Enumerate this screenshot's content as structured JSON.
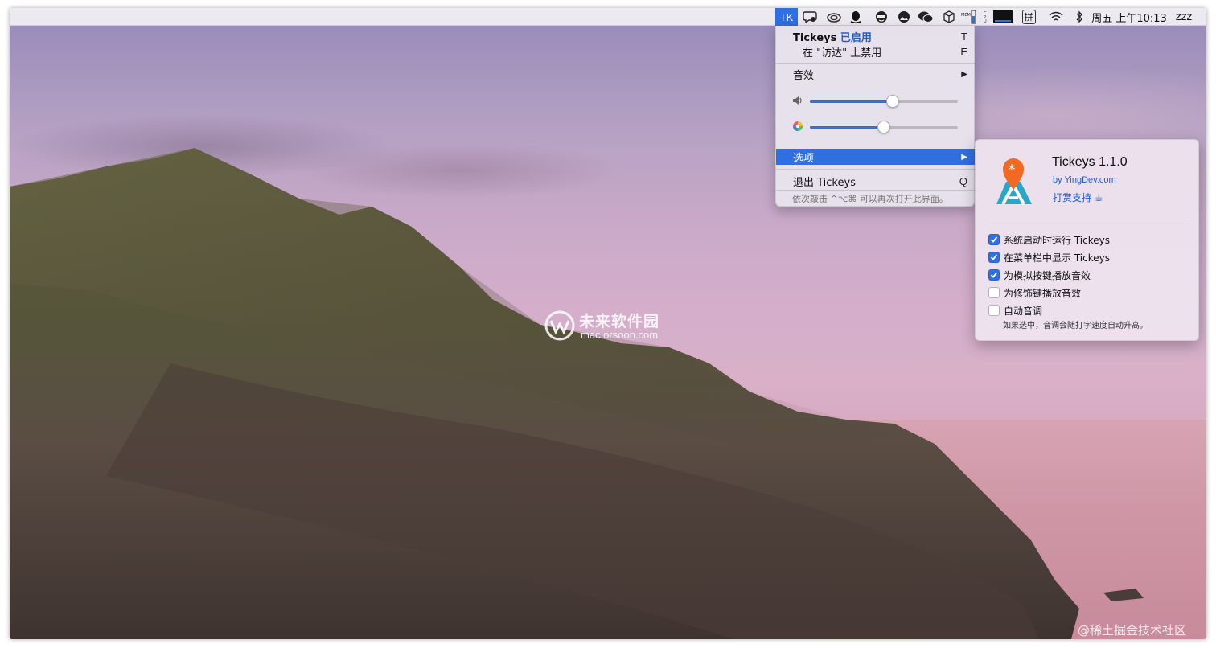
{
  "menubar": {
    "app_button": "TK",
    "status_icons": [
      "chat-bubble-icon",
      "creative-cloud-icon",
      "qq-penguin-icon",
      "character-face-icon",
      "photo-icon",
      "wechat-icon",
      "cube-icon",
      "memory-meter-icon",
      "cpu-meter-icon",
      "display-icon",
      "input-method-icon",
      "wifi-icon",
      "bluetooth-icon"
    ],
    "input_method": "拼",
    "clock": "周五 上午10:13",
    "user": "zzz"
  },
  "menu": {
    "app_name": "Tickeys",
    "status": "已启用",
    "toggle_key": "T",
    "disable_label": "在 \"访达\" 上禁用",
    "disable_key": "E",
    "sound_label": "音效",
    "volume_level": 0.56,
    "pitch_level": 0.5,
    "options_label": "选项",
    "quit_label": "退出 Tickeys",
    "quit_key": "Q",
    "hint": "依次敲击 ^⌥⌘ 可以再次打开此界面。",
    "submenu_arrow": "▶"
  },
  "panel": {
    "title": "Tickeys 1.1.0",
    "by": "by YingDev.com",
    "tip": "打赏支持 ☕",
    "options": [
      {
        "label": "系统启动时运行 Tickeys",
        "checked": true
      },
      {
        "label": "在菜单栏中显示 Tickeys",
        "checked": true
      },
      {
        "label": "为模拟按键播放音效",
        "checked": true
      },
      {
        "label": "为修饰键播放音效",
        "checked": false
      },
      {
        "label": "自动音调",
        "checked": false
      }
    ],
    "note": "如果选中，音调会随打字速度自动升高。"
  },
  "watermark": {
    "site_name": "未来软件园",
    "site_url": "mac.orsoon.com",
    "community": "@稀土掘金技术社区"
  },
  "colors": {
    "accent": "#2f6fe0",
    "link": "#1f5fd6"
  }
}
